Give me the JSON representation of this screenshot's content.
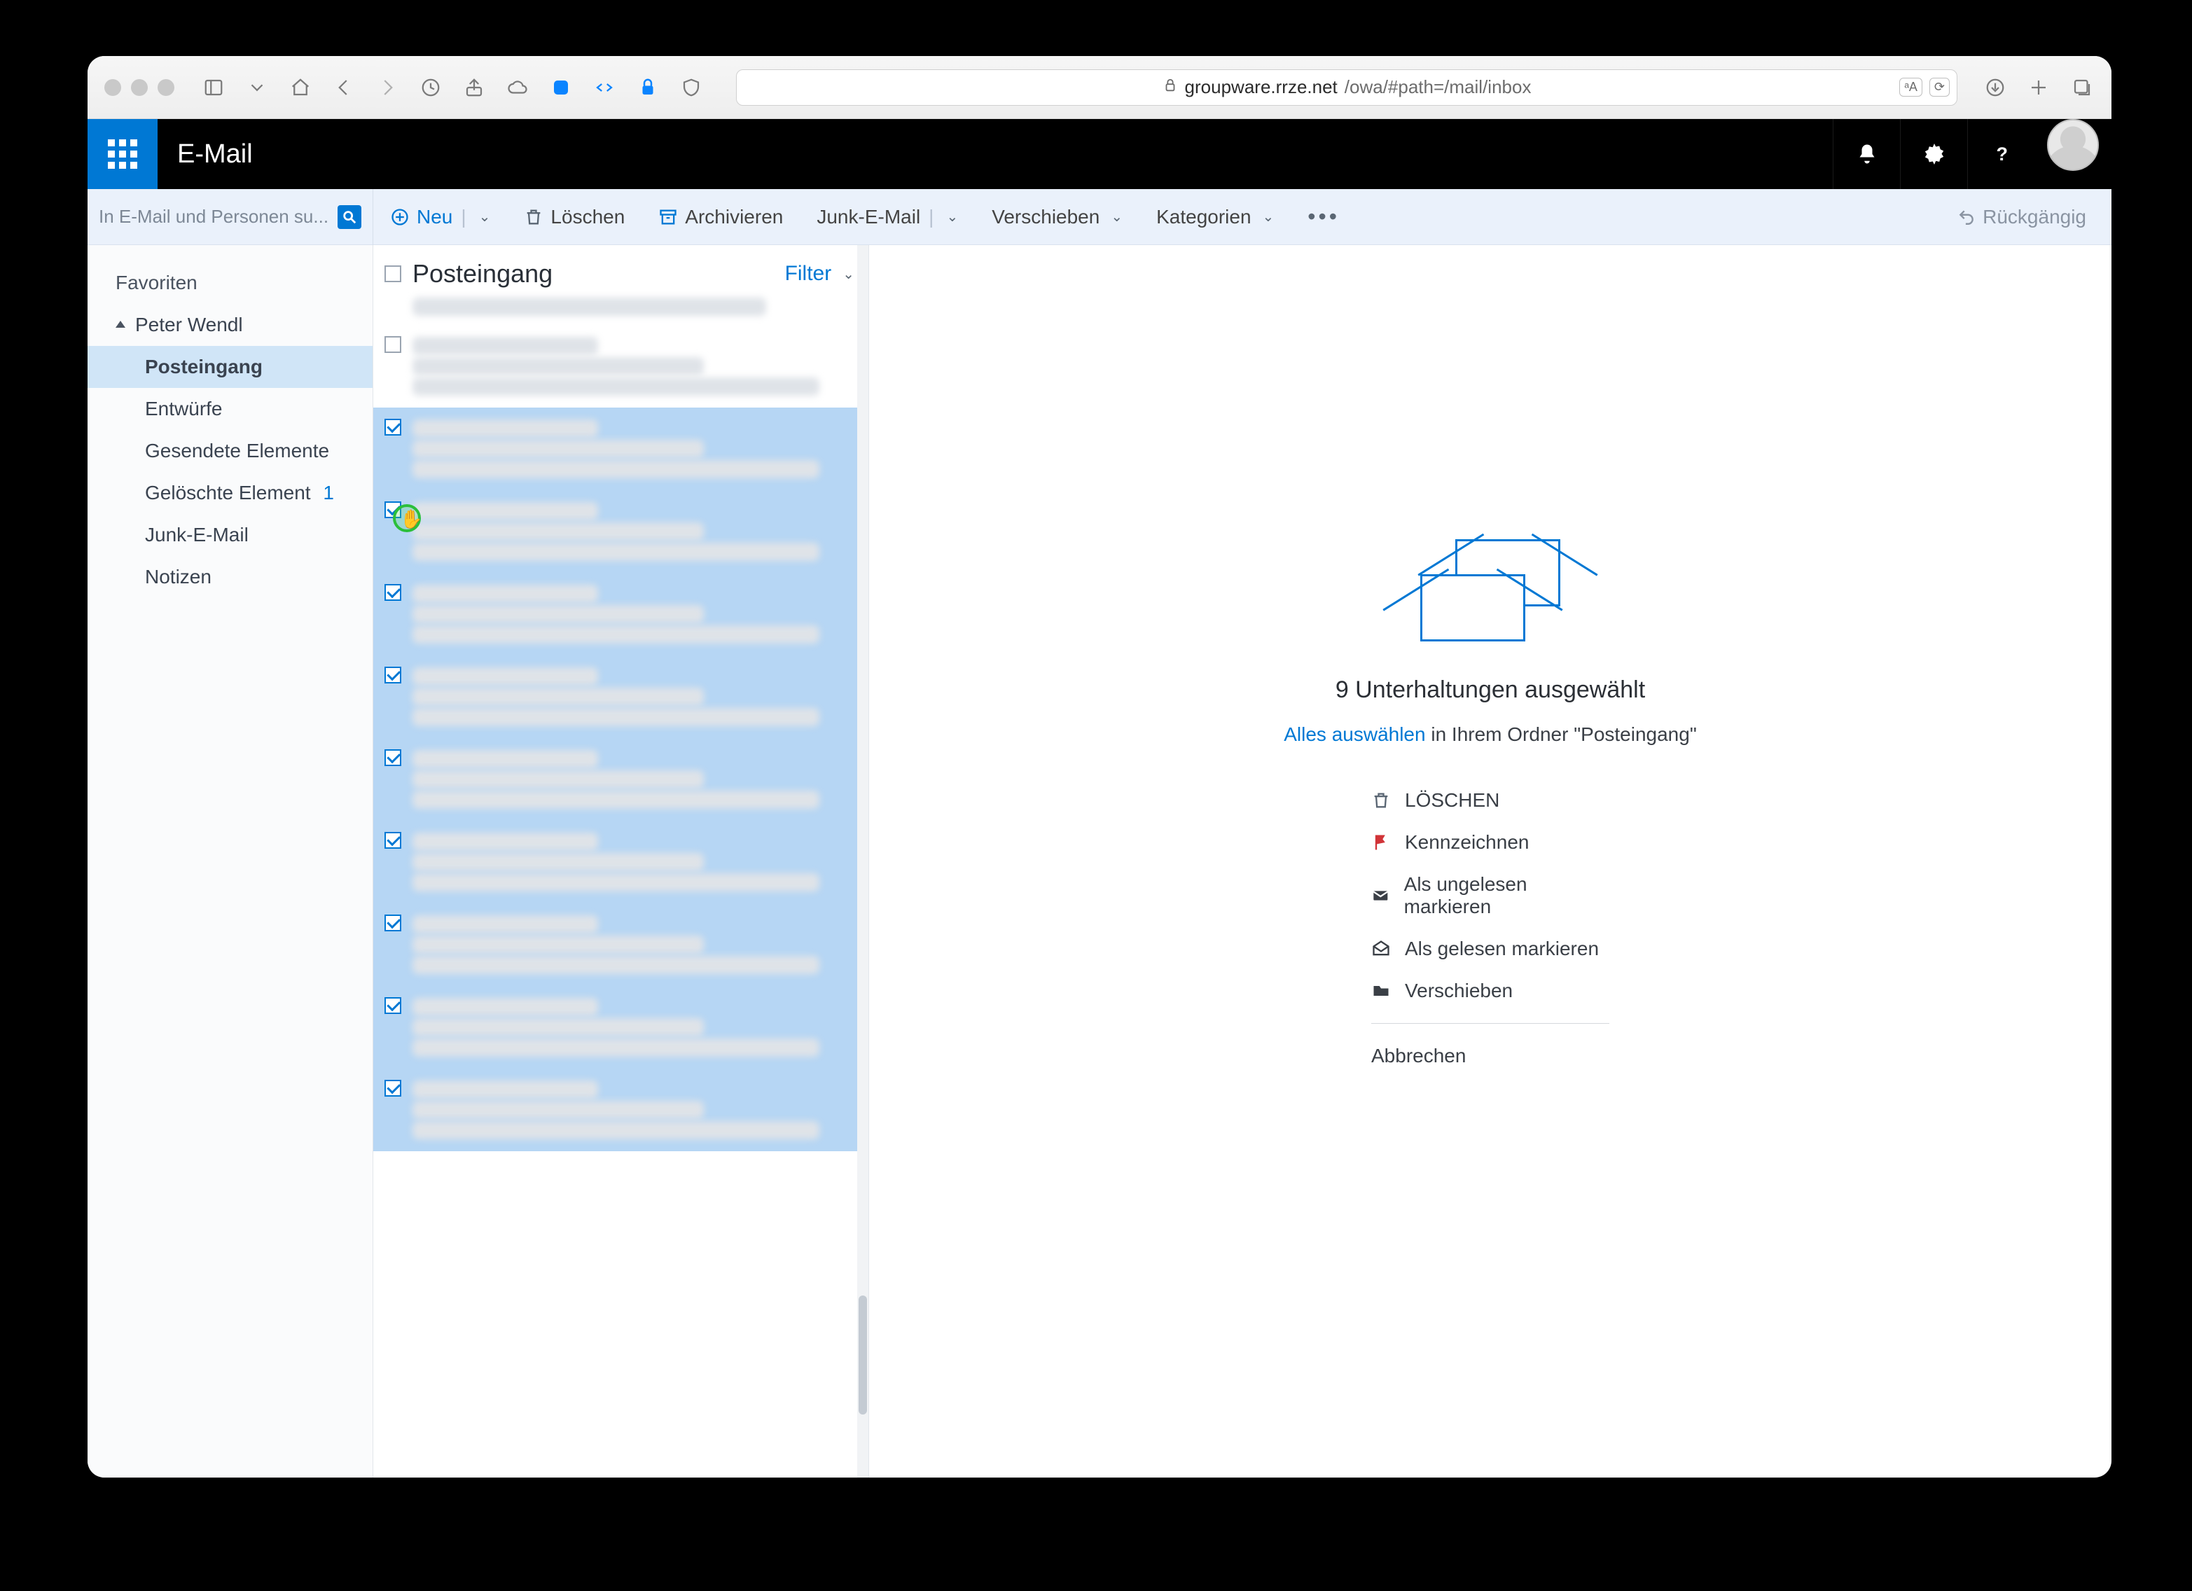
{
  "browser": {
    "url_host": "groupware.rrze.net",
    "url_path": "/owa/#path=/mail/inbox"
  },
  "header": {
    "app_title": "E-Mail"
  },
  "search": {
    "placeholder": "In E-Mail und Personen su..."
  },
  "commands": {
    "new": "Neu",
    "delete": "Löschen",
    "archive": "Archivieren",
    "junk": "Junk-E-Mail",
    "move": "Verschieben",
    "categories": "Kategorien",
    "undo": "Rückgängig"
  },
  "nav": {
    "favorites": "Favoriten",
    "account": "Peter Wendl",
    "folders": {
      "inbox": "Posteingang",
      "drafts": "Entwürfe",
      "sent": "Gesendete Elemente",
      "deleted": "Gelöschte Element",
      "deleted_count": "1",
      "junk": "Junk-E-Mail",
      "notes": "Notizen"
    }
  },
  "list": {
    "title": "Posteingang",
    "filter": "Filter"
  },
  "reading": {
    "title": "9 Unterhaltungen ausgewählt",
    "select_all": "Alles auswählen",
    "select_all_suffix": " in Ihrem Ordner \"Posteingang\"",
    "actions": {
      "delete": "LÖSCHEN",
      "flag": "Kennzeichnen",
      "mark_unread": "Als ungelesen markieren",
      "mark_read": "Als gelesen markieren",
      "move": "Verschieben"
    },
    "cancel": "Abbrechen"
  }
}
